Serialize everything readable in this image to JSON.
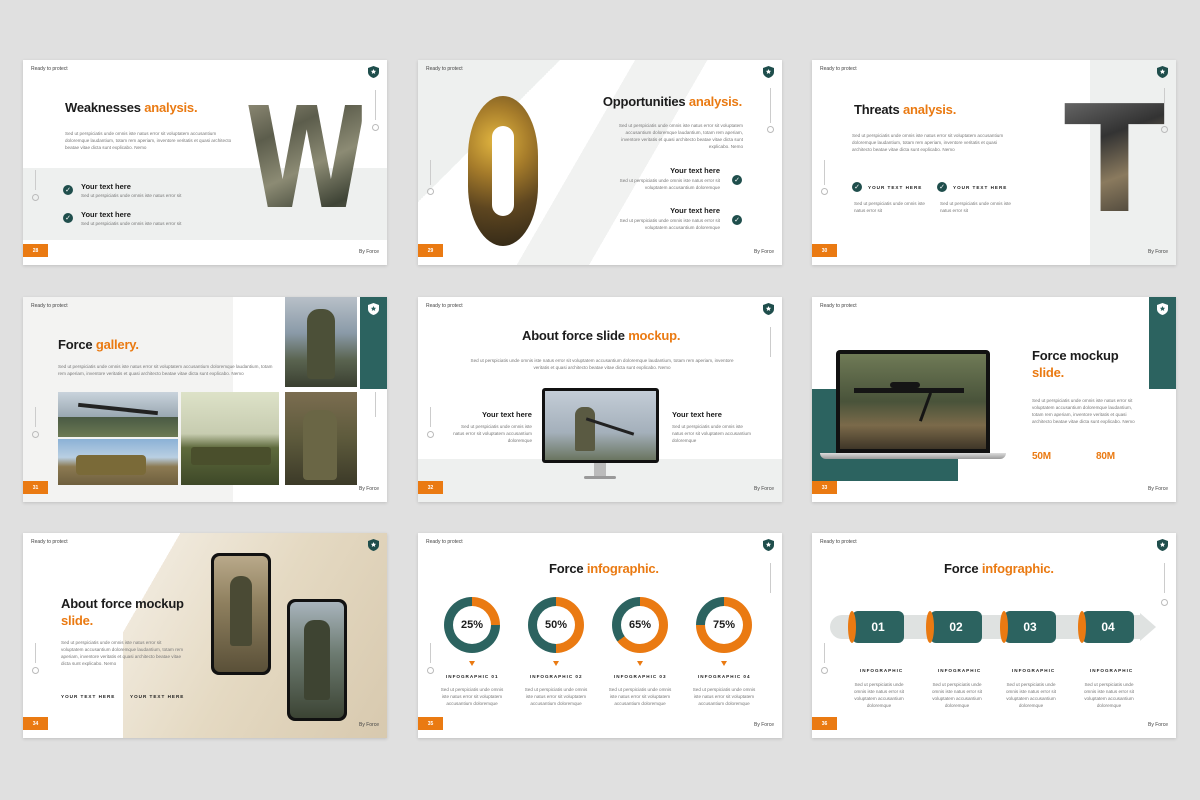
{
  "common": {
    "ready": "Ready to protect",
    "by": "By Force",
    "lorem_short": "Sed ut perspiciatis unde omnis iste natus error sit voluptatem accusantium doloremque laudantium, totam rem aperiam, inventore veritatis et quasi architecto beatae vitae dicta sunt explicabo. Nemo",
    "lorem_tiny": "Sed ut perspiciatis unde omnis iste natus error sit",
    "lorem_medium": "Sed ut perspiciatis unde omnis iste natus error sit voluptatem accusantium doloremque",
    "your_text": "Your text here",
    "your_text_upper": "YOUR TEXT HERE",
    "infographic": "INFOGRAPHIC"
  },
  "colors": {
    "accent": "#ea7a12",
    "teal": "#2c6360",
    "dark_teal": "#1f4e4c"
  },
  "slides": {
    "s28": {
      "num": "28",
      "title_a": "Weaknesses",
      "title_b": "analysis.",
      "letter": "W"
    },
    "s29": {
      "num": "29",
      "title_a": "Opportunities",
      "title_b": "analysis.",
      "letter": "O"
    },
    "s30": {
      "num": "30",
      "title_a": "Threats",
      "title_b": "analysis.",
      "letter": "T"
    },
    "s31": {
      "num": "31",
      "title_a": "Force",
      "title_b": "gallery."
    },
    "s32": {
      "num": "32",
      "title_a": "About force slide",
      "title_b": "mockup."
    },
    "s33": {
      "num": "33",
      "title_a": "Force mockup",
      "title_b": "slide.",
      "stat1": "50M",
      "stat2": "80M"
    },
    "s34": {
      "num": "34",
      "title_a": "About force mockup",
      "title_b": "slide."
    },
    "s35": {
      "num": "35",
      "title_a": "Force",
      "title_b": "infographic.",
      "items": [
        {
          "pct": "25%",
          "label": "INFOGRAPHIC 01",
          "value": 25
        },
        {
          "pct": "50%",
          "label": "INFOGRAPHIC 02",
          "value": 50
        },
        {
          "pct": "65%",
          "label": "INFOGRAPHIC 03",
          "value": 65
        },
        {
          "pct": "75%",
          "label": "INFOGRAPHIC 04",
          "value": 75
        }
      ]
    },
    "s36": {
      "num": "36",
      "title_a": "Force",
      "title_b": "infographic.",
      "steps": [
        "01",
        "02",
        "03",
        "04"
      ]
    }
  }
}
